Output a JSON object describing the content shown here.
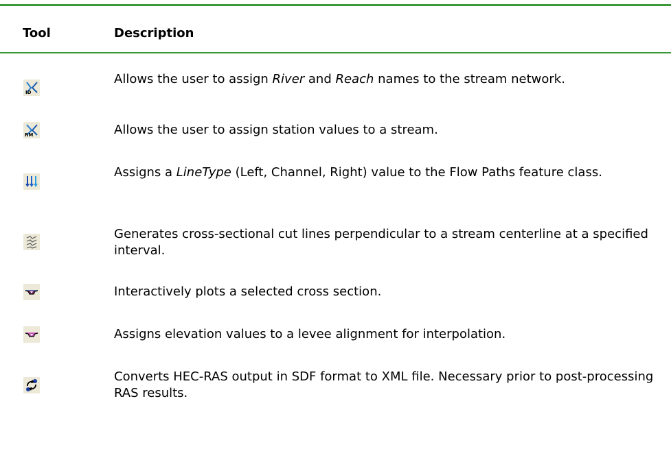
{
  "table": {
    "headers": {
      "tool": "Tool",
      "description": "Description"
    },
    "rows": [
      {
        "icon": "river-reach-id-icon",
        "desc_parts": [
          "Allows the user to assign ",
          "River",
          " and ",
          "Reach",
          " names to the stream network."
        ]
      },
      {
        "icon": "river-station-rm-icon",
        "description": "Allows the user to assign station values to a stream."
      },
      {
        "icon": "flow-path-arrows-icon",
        "desc_parts": [
          "Assigns a ",
          "LineType",
          " (Left, Channel, Right) value to the Flow Paths feature class."
        ]
      },
      {
        "icon": "xs-cutlines-icon",
        "description": "Generates cross-sectional cut lines perpendicular to a stream centerline at a specified interval."
      },
      {
        "icon": "plot-cross-section-icon",
        "description": "Interactively plots a selected cross section."
      },
      {
        "icon": "levee-elevation-icon",
        "description": "Assigns elevation values to a levee alignment for interpolation."
      },
      {
        "icon": "sdf-to-xml-convert-icon",
        "description": "Converts HEC-RAS output in SDF format to XML file.  Necessary prior to post-processing RAS results."
      }
    ]
  },
  "colors": {
    "rule": "#3a9a3a",
    "icon_background": "#ece9d8"
  }
}
